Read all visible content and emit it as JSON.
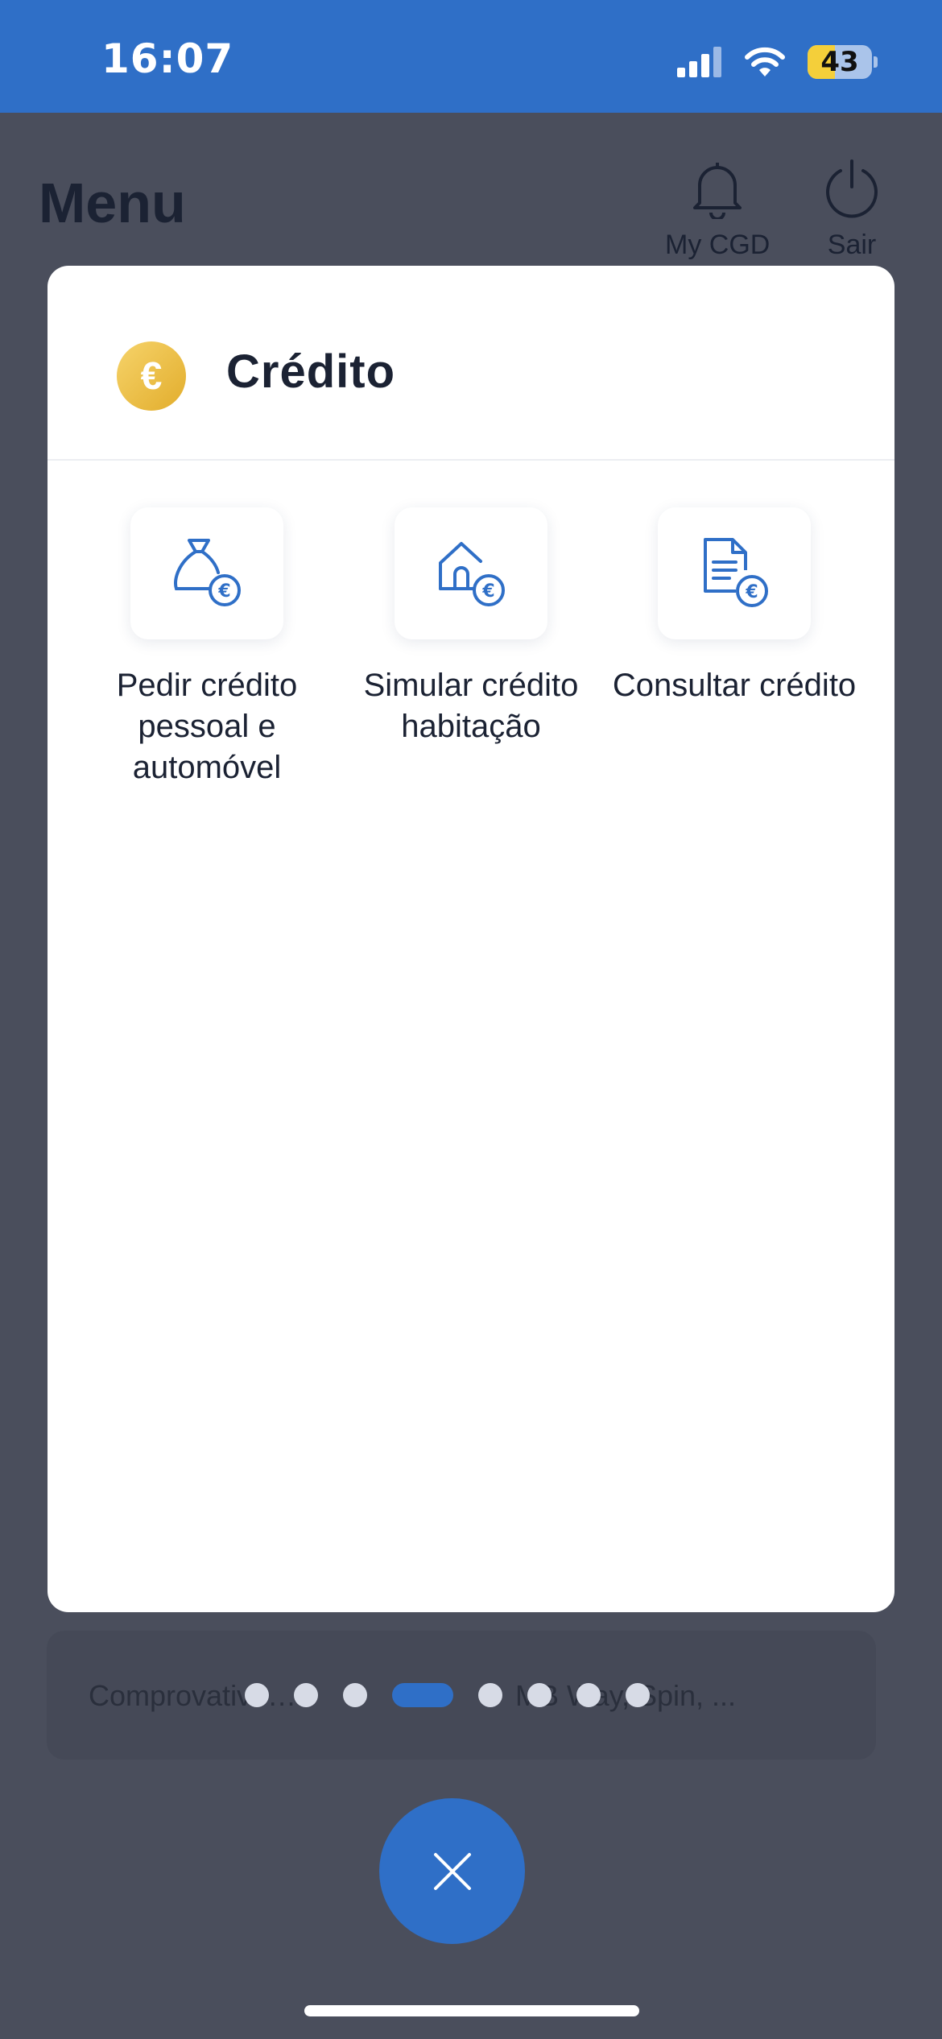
{
  "status_bar": {
    "time": "16:07",
    "battery": "43",
    "battery_level": 0.43
  },
  "menu": {
    "title": "Menu"
  },
  "header_actions": [
    {
      "label": "My CGD",
      "icon": "bell-icon"
    },
    {
      "label": "Sair",
      "icon": "power-icon"
    }
  ],
  "modal": {
    "title": "Crédito",
    "icon": "euro-coin-icon",
    "options": [
      {
        "label": "Pedir crédito pessoal e automóvel",
        "icon": "money-bag-euro-icon"
      },
      {
        "label": "Simular crédito habitação",
        "icon": "house-euro-icon"
      },
      {
        "label": "Consultar crédito",
        "icon": "document-euro-icon"
      }
    ]
  },
  "background_card": {
    "left_text": "Comprovativo…",
    "right_text": "MB Way, Spin, ..."
  },
  "pagination": {
    "total": 8,
    "active": 4
  },
  "colors": {
    "accent": "#2f6fc7",
    "coin": "#e8b83a",
    "overlay": "#4a4e5c"
  }
}
